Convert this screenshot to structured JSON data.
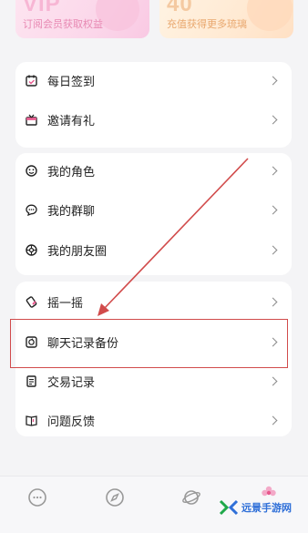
{
  "promos": {
    "vip": {
      "title": "VIP",
      "subtitle": "订阅会员获取权益"
    },
    "coin": {
      "title": "40",
      "subtitle": "充值获得更多琉璃"
    }
  },
  "menu": {
    "group1": [
      {
        "label": "每日签到",
        "icon": "calendar-check-icon"
      },
      {
        "label": "邀请有礼",
        "icon": "gift-box-icon"
      }
    ],
    "group2": [
      {
        "label": "我的角色",
        "icon": "smiley-icon"
      },
      {
        "label": "我的群聊",
        "icon": "chat-bubble-icon"
      },
      {
        "label": "我的朋友圈",
        "icon": "aperture-icon"
      }
    ],
    "group3": [
      {
        "label": "摇一摇",
        "icon": "shake-icon"
      },
      {
        "label": "聊天记录备份",
        "icon": "backup-icon"
      },
      {
        "label": "交易记录",
        "icon": "receipt-icon"
      },
      {
        "label": "问题反馈",
        "icon": "feedback-book-icon"
      }
    ]
  },
  "tabbar": [
    "chat-icon",
    "compass-icon",
    "planet-icon",
    "profile-flower-icon"
  ],
  "watermark": {
    "text": "远景手游网"
  },
  "colors": {
    "annotation": "#d14b4b",
    "brand_pink": "#f3a9c8",
    "vip_text": "#e889b3",
    "coin_text": "#e9a86f"
  }
}
